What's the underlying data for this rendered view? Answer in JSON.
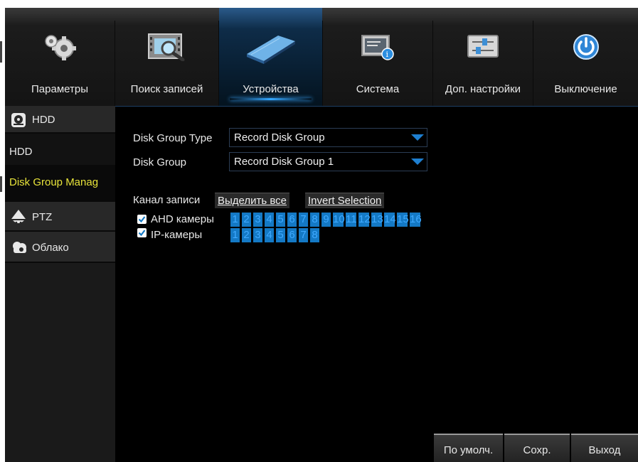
{
  "topnav": {
    "items": [
      {
        "label": "Параметры",
        "icon": "gears-icon"
      },
      {
        "label": "Поиск записей",
        "icon": "video-search-icon"
      },
      {
        "label": "Устройства",
        "icon": "hard-drive-icon",
        "active": true
      },
      {
        "label": "Система",
        "icon": "system-info-icon"
      },
      {
        "label": "Доп. настройки",
        "icon": "sliders-icon"
      },
      {
        "label": "Выключение",
        "icon": "power-icon"
      }
    ]
  },
  "sidebar": {
    "items": [
      {
        "label": "HDD",
        "icon": "hdd-icon"
      },
      {
        "label": "HDD"
      },
      {
        "label": "Disk Group Manag",
        "selected": true
      },
      {
        "label": "PTZ",
        "icon": "ptz-camera-icon"
      },
      {
        "label": "Облако",
        "icon": "cloud-icon"
      }
    ]
  },
  "form": {
    "disk_group_type_label": "Disk Group Type",
    "disk_group_type_value": "Record Disk Group",
    "disk_group_label": "Disk Group",
    "disk_group_value": "Record Disk Group 1",
    "record_channel_label": "Канал записи",
    "select_all_label": "Выделить все",
    "invert_selection_label": "Invert Selection",
    "ahd_label": "AHD камеры",
    "ip_label": "IP-камеры",
    "ahd_checked": true,
    "ip_checked": true,
    "ahd_channels": [
      "1",
      "2",
      "3",
      "4",
      "5",
      "6",
      "7",
      "8",
      "9",
      "10",
      "11",
      "12",
      "13",
      "14",
      "15",
      "16"
    ],
    "ip_channels": [
      "1",
      "2",
      "3",
      "4",
      "5",
      "6",
      "7",
      "8"
    ]
  },
  "footer": {
    "default_label": "По умолч.",
    "save_label": "Сохр.",
    "exit_label": "Выход"
  },
  "colors": {
    "accent_blue": "#1479c5",
    "selected_text": "#e7e33a",
    "active_tab": "#0e2c48"
  }
}
